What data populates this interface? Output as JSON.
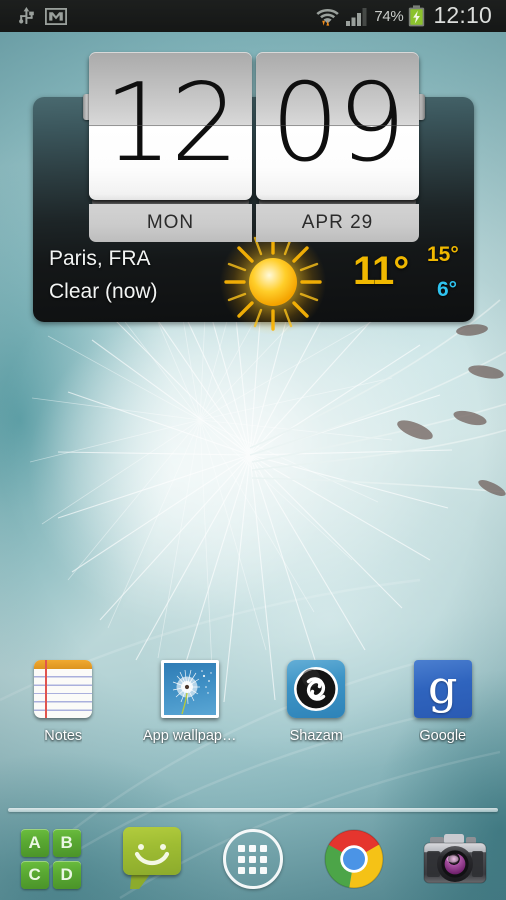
{
  "status_bar": {
    "left_icons": [
      {
        "name": "usb-icon",
        "glyph": "usb"
      },
      {
        "name": "gmail-icon",
        "glyph": "envelope"
      }
    ],
    "wifi_icon": "wifi-icon",
    "data_transfer_icon": "data-updown-icon",
    "signal_icon": "cellular-signal-icon",
    "battery_percent": "74%",
    "battery_icon": "battery-charging-icon",
    "time": "12:10"
  },
  "widget": {
    "name": "flip-clock-weather-widget",
    "clock": {
      "hour": "12",
      "minute": "09",
      "day_label": "MON",
      "date_label": "APR 29"
    },
    "weather": {
      "city": "Paris, FRA",
      "condition": "Clear (now)",
      "current_temp": "11°",
      "high_temp": "15°",
      "low_temp": "6°",
      "condition_icon": "sun-icon",
      "high_color": "#f0b800",
      "low_color": "#2fc3ef",
      "temp_color": "#f0b800"
    }
  },
  "app_grid": [
    {
      "label": "Notes",
      "icon": "notepad-icon"
    },
    {
      "label": "App wallpap…",
      "icon": "wallpaper-photo-icon"
    },
    {
      "label": "Shazam",
      "icon": "shazam-icon"
    },
    {
      "label": "Google",
      "icon": "google-search-icon"
    }
  ],
  "dock": [
    {
      "label": "Word game",
      "icon": "abcd-tiles-icon",
      "tiles": [
        "A",
        "B",
        "C",
        "D"
      ]
    },
    {
      "label": "Messaging",
      "icon": "messaging-smiley-icon"
    },
    {
      "label": "Apps",
      "icon": "app-drawer-icon"
    },
    {
      "label": "Chrome",
      "icon": "chrome-icon"
    },
    {
      "label": "Camera",
      "icon": "camera-icon"
    }
  ],
  "theme": {
    "status_bar_bg": "#171918",
    "status_text": "#dcdedc",
    "widget_panel_dark": "#111314",
    "wallpaper_teal": "#8ebcc2"
  }
}
